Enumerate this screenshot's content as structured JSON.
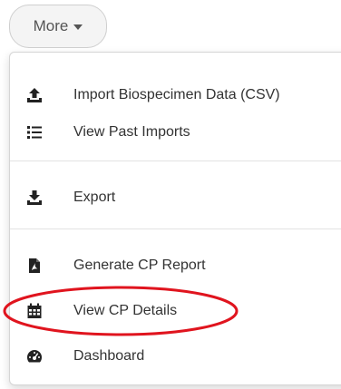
{
  "toolbar": {
    "more_label": "More"
  },
  "menu": {
    "items": [
      {
        "label": "Import Biospecimen Data (CSV)",
        "icon": "upload-icon"
      },
      {
        "label": "View Past Imports",
        "icon": "list-icon"
      },
      {
        "label": "Export",
        "icon": "download-icon"
      },
      {
        "label": "Generate CP Report",
        "icon": "pdf-file-icon"
      },
      {
        "label": "View CP Details",
        "icon": "calendar-icon"
      },
      {
        "label": "Dashboard",
        "icon": "dashboard-icon"
      }
    ]
  },
  "colors": {
    "highlight": "#e0141e",
    "icon": "#222222",
    "text": "#333333"
  }
}
